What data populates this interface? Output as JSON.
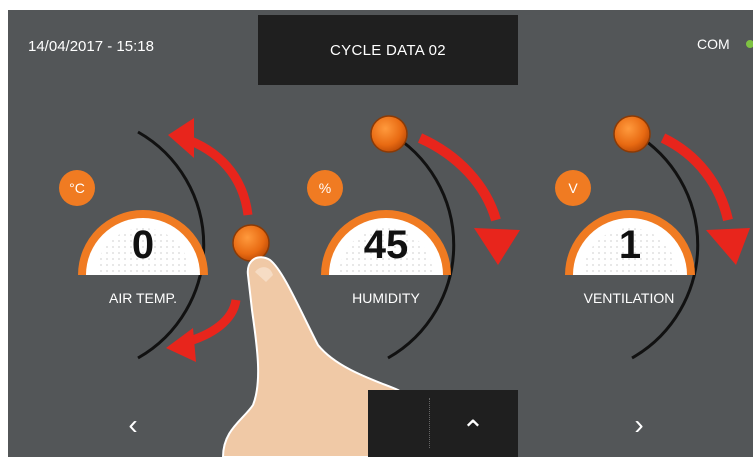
{
  "header": {
    "datetime": "14/04/2017 - 15:18",
    "title": "CYCLE DATA 02",
    "com_label": "COM"
  },
  "dials": [
    {
      "unit": "°C",
      "value": "0",
      "label": "AIR TEMP."
    },
    {
      "unit": "%",
      "value": "45",
      "label": "HUMIDITY"
    },
    {
      "unit": "V",
      "value": "1",
      "label": "VENTILATION"
    }
  ],
  "nav": {
    "prev_glyph": "‹",
    "up_glyph": "⌃",
    "next_glyph": "›"
  },
  "colors": {
    "screen_bg": "#535658",
    "accent_orange": "#f07b22",
    "arrow_red": "#e8251c",
    "status_green": "#7ec242"
  }
}
